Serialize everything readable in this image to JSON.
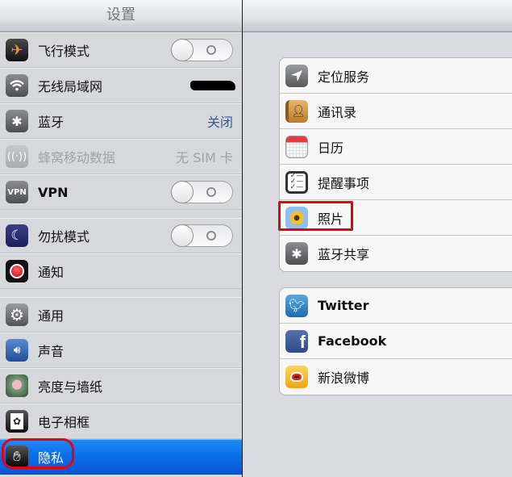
{
  "sidebar": {
    "title": "设置",
    "items": [
      {
        "label": "飞行模式",
        "icon": "airplane-icon",
        "control": "toggle",
        "state": "off"
      },
      {
        "label": "无线局域网",
        "icon": "wifi-icon",
        "value": "(redacted)"
      },
      {
        "label": "蓝牙",
        "icon": "bluetooth-icon",
        "value": "关闭"
      },
      {
        "label": "蜂窝移动数据",
        "icon": "cellular-icon",
        "value": "无 SIM 卡",
        "disabled": true
      },
      {
        "label": "VPN",
        "icon": "vpn-icon",
        "icon_text": "VPN",
        "control": "toggle",
        "state": "off"
      },
      {
        "label": "勿扰模式",
        "icon": "moon-icon",
        "control": "toggle",
        "state": "off"
      },
      {
        "label": "通知",
        "icon": "notifications-icon"
      },
      {
        "label": "通用",
        "icon": "gear-icon"
      },
      {
        "label": "声音",
        "icon": "speaker-icon"
      },
      {
        "label": "亮度与墙纸",
        "icon": "wallpaper-icon"
      },
      {
        "label": "电子相框",
        "icon": "picture-frame-icon"
      },
      {
        "label": "隐私",
        "icon": "hand-icon",
        "selected": true
      }
    ]
  },
  "main": {
    "groups": [
      {
        "items": [
          {
            "label": "定位服务",
            "icon": "location-arrow-icon"
          },
          {
            "label": "通讯录",
            "icon": "contacts-icon"
          },
          {
            "label": "日历",
            "icon": "calendar-icon"
          },
          {
            "label": "提醒事项",
            "icon": "reminders-icon"
          },
          {
            "label": "照片",
            "icon": "photos-icon",
            "highlighted": true
          },
          {
            "label": "蓝牙共享",
            "icon": "bluetooth-icon"
          }
        ]
      },
      {
        "items": [
          {
            "label": "Twitter",
            "icon": "twitter-icon"
          },
          {
            "label": "Facebook",
            "icon": "facebook-icon"
          },
          {
            "label": "新浪微博",
            "icon": "weibo-icon"
          }
        ]
      }
    ]
  },
  "colors": {
    "selected_row": "#0a6de8",
    "annotation": "#e8000b",
    "value_blue": "#3a5a8c"
  }
}
